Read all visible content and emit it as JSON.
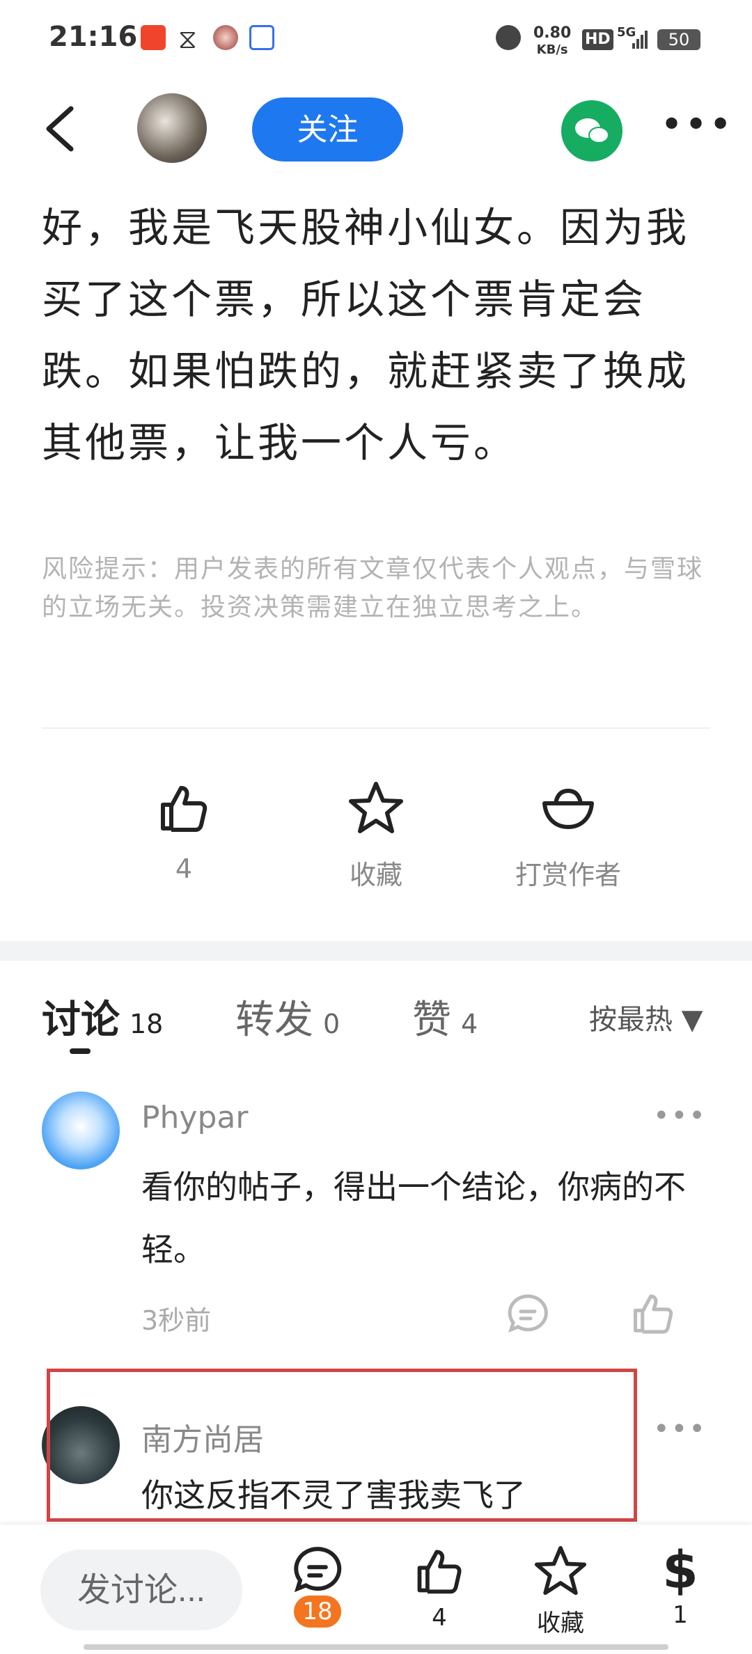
{
  "status_bar": {
    "time": "21:16",
    "net_speed_value": "0.80",
    "net_speed_unit": "KB/s",
    "hd_label": "HD",
    "signal_label": "5G",
    "battery": "50",
    "icons": [
      "taobao-icon",
      "hourglass-icon",
      "avatar-app-icon",
      "baicizhan-100-icon",
      "alarm-icon",
      "signal-icon"
    ]
  },
  "nav": {
    "follow_label": "关注",
    "more_label": "•••"
  },
  "article": {
    "body": "好，我是飞天股神小仙女。因为我买了这个票，所以这个票肯定会跌。如果怕跌的，就赶紧卖了换成其他票，让我一个人亏。",
    "risk_notice": "风险提示：用户发表的所有文章仅代表个人观点，与雪球的立场无关。投资决策需建立在独立思考之上。"
  },
  "actions": {
    "like_count": "4",
    "favorite_label": "收藏",
    "tip_label": "打赏作者"
  },
  "tabs": {
    "discuss_label": "讨论",
    "discuss_count": "18",
    "repost_label": "转发",
    "repost_count": "0",
    "likes_label": "赞",
    "likes_count": "4",
    "sort_label": "按最热 ▼"
  },
  "comments": [
    {
      "name": "Phypar",
      "text": "看你的帖子，得出一个结论，你病的不轻。",
      "time": "3秒前",
      "more": "•••"
    },
    {
      "name": "南方尚居",
      "text": "你这反指不灵了害我卖飞了",
      "more": "•••"
    }
  ],
  "bottom_bar": {
    "input_placeholder": "发讨论...",
    "comment_count": "18",
    "like_count": "4",
    "favorite_label": "收藏",
    "tip_count": "1"
  },
  "colors": {
    "accent_blue": "#1e78f0",
    "wechat_green": "#16ad63",
    "badge_orange": "#f4751f",
    "highlight_red": "#d14545"
  }
}
